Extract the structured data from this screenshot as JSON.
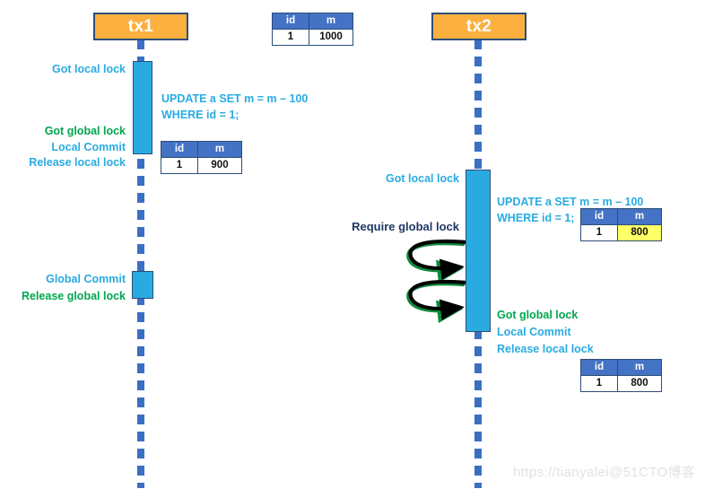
{
  "diagram": {
    "title": "Distributed transaction global lock sequence diagram",
    "colors": {
      "actor_fill": "#FBB040",
      "actor_border": "#2E4E78",
      "activation_fill": "#29ABE2",
      "lifeline": "#3A6FC4",
      "table_header": "#4472C4",
      "highlight": "#FFFF66",
      "text_blue": "#29ABE2",
      "text_green": "#00A64F",
      "text_navy": "#1F3864"
    }
  },
  "actors": [
    {
      "id": "tx1",
      "label": "tx1"
    },
    {
      "id": "tx2",
      "label": "tx2"
    }
  ],
  "tx1": {
    "labels": {
      "got_local_lock": "Got local lock",
      "got_global_lock": "Got global lock",
      "local_commit": "Local Commit",
      "release_local_lock": "Release local lock",
      "global_commit": "Global Commit",
      "release_global_lock": "Release global lock"
    },
    "sql": {
      "line1": "UPDATE a SET m = m – 100",
      "line2": "WHERE id = 1;"
    }
  },
  "tx2": {
    "labels": {
      "got_local_lock": "Got local lock",
      "require_global_lock": "Require global lock",
      "got_global_lock": "Got global lock",
      "local_commit": "Local Commit",
      "release_local_lock": "Release local lock"
    },
    "sql": {
      "line1": "UPDATE a SET m = m – 100",
      "line2": "WHERE id = 1;"
    }
  },
  "tables": {
    "columns": {
      "id": "id",
      "m": "m"
    },
    "initial": {
      "id": "1",
      "m": "1000",
      "highlight": false
    },
    "tx1_after": {
      "id": "1",
      "m": "900",
      "highlight": false
    },
    "tx2_pending": {
      "id": "1",
      "m": "800",
      "highlight": true
    },
    "tx2_after": {
      "id": "1",
      "m": "800",
      "highlight": false
    }
  },
  "watermark": "https://tianyalei@51CTO博客"
}
